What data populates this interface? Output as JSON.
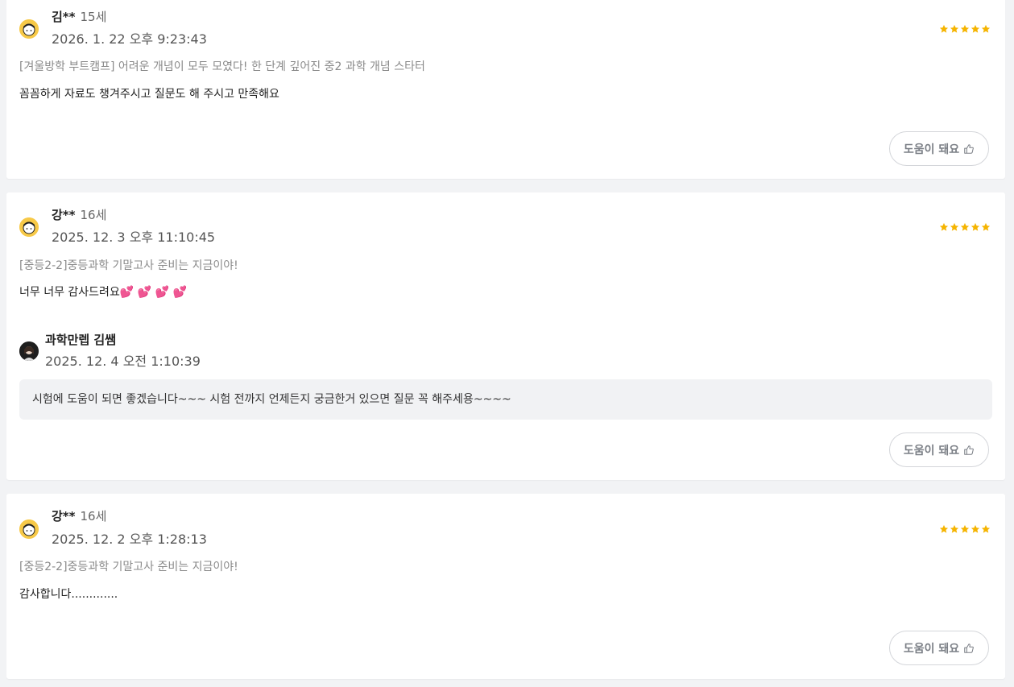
{
  "colors": {
    "star": "#f5b400",
    "avatar_bg": "#f7c948",
    "background": "#f2f3f5"
  },
  "reviews": [
    {
      "name": "김**",
      "age": "15세",
      "date": "2026. 1. 22 오후 9:23:43",
      "rating": 5,
      "course": "[겨울방학 부트캠프] 어려운 개념이 모두 모였다! 한 단계 깊어진 중2 과학 개념 스타터",
      "comment": "꼼꼼하게 자료도 챙겨주시고 질문도 해 주시고 만족해요",
      "helpful_label": "도움이 돼요",
      "avatar_icon": "girl-face-icon"
    },
    {
      "name": "강**",
      "age": "16세",
      "date": "2025. 12. 3 오후 11:10:45",
      "rating": 5,
      "course": "[중등2-2]중등과학 기말고사 준비는 지금이야!",
      "comment": "너무 너무 감사드려요💕 💕 💕 💕",
      "reply": {
        "name": "과학만렙 김쌤",
        "date": "2025. 12. 4 오전 1:10:39",
        "text": "시험에 도움이 되면 좋겠습니다~~~ 시험 전까지 언제든지 궁금한거 있으면 질문 꼭 해주세용~~~~"
      },
      "helpful_label": "도움이 돼요",
      "avatar_icon": "girl-face-icon"
    },
    {
      "name": "강**",
      "age": "16세",
      "date": "2025. 12. 2 오후 1:28:13",
      "rating": 5,
      "course": "[중등2-2]중등과학 기말고사 준비는 지금이야!",
      "comment": "감사합니다.............",
      "helpful_label": "도움이 돼요",
      "avatar_icon": "girl-face-icon"
    }
  ]
}
